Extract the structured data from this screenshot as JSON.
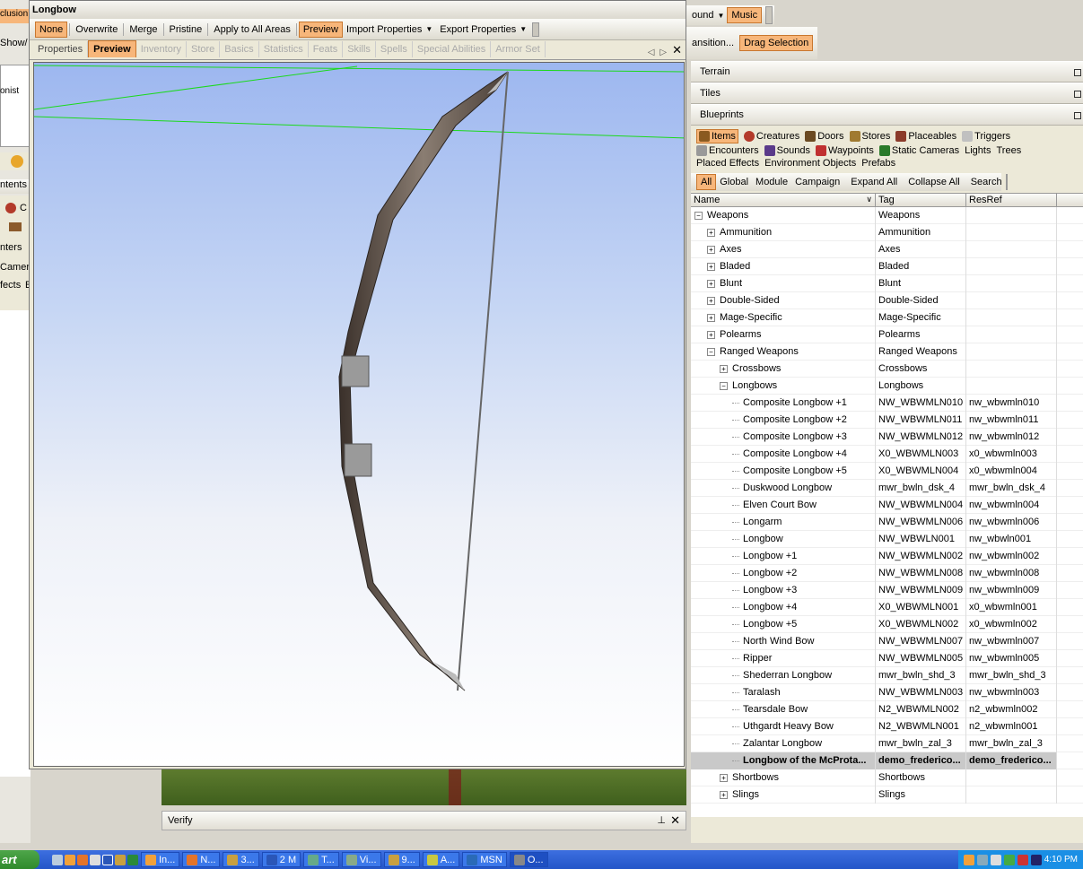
{
  "dialog": {
    "title": "Longbow",
    "toolbar": [
      "None",
      "Overwrite",
      "Merge",
      "Pristine",
      "Apply to All Areas",
      "Preview",
      "Import Properties",
      "Export Properties"
    ],
    "tabs": [
      "Properties",
      "Preview",
      "Inventory",
      "Store",
      "Basics",
      "Statistics",
      "Feats",
      "Skills",
      "Spells",
      "Special Abilities",
      "Armor Set"
    ]
  },
  "top_right": {
    "sound_label": "ound",
    "music": "Music",
    "transition": "ansition...",
    "drag_selection": "Drag Selection"
  },
  "left_fragments": {
    "inclusion": "clusion",
    "show": "Show/",
    "onist": "onist",
    "contents": "ntents",
    "c_item": "C",
    "ers": "nters",
    "camera": "Camer",
    "effects": "fects",
    "e": "E"
  },
  "sections": [
    "Terrain",
    "Tiles",
    "Blueprints"
  ],
  "blueprint_types": [
    "Items",
    "Creatures",
    "Doors",
    "Stores",
    "Placeables",
    "Triggers",
    "Encounters",
    "Sounds",
    "Waypoints",
    "Static Cameras",
    "Lights",
    "Trees",
    "Placed Effects",
    "Environment Objects",
    "Prefabs"
  ],
  "filter": [
    "All",
    "Global",
    "Module",
    "Campaign",
    "Expand All",
    "Collapse All",
    "Search"
  ],
  "columns": [
    "Name",
    "Tag",
    "ResRef"
  ],
  "rows": [
    {
      "lvl": 0,
      "exp": "−",
      "name": "Weapons",
      "tag": "Weapons",
      "res": ""
    },
    {
      "lvl": 1,
      "exp": "+",
      "name": "Ammunition",
      "tag": "Ammunition",
      "res": ""
    },
    {
      "lvl": 1,
      "exp": "+",
      "name": "Axes",
      "tag": "Axes",
      "res": ""
    },
    {
      "lvl": 1,
      "exp": "+",
      "name": "Bladed",
      "tag": "Bladed",
      "res": ""
    },
    {
      "lvl": 1,
      "exp": "+",
      "name": "Blunt",
      "tag": "Blunt",
      "res": ""
    },
    {
      "lvl": 1,
      "exp": "+",
      "name": "Double-Sided",
      "tag": "Double-Sided",
      "res": ""
    },
    {
      "lvl": 1,
      "exp": "+",
      "name": "Mage-Specific",
      "tag": "Mage-Specific",
      "res": ""
    },
    {
      "lvl": 1,
      "exp": "+",
      "name": "Polearms",
      "tag": "Polearms",
      "res": ""
    },
    {
      "lvl": 1,
      "exp": "−",
      "name": "Ranged Weapons",
      "tag": "Ranged Weapons",
      "res": ""
    },
    {
      "lvl": 2,
      "exp": "+",
      "name": "Crossbows",
      "tag": "Crossbows",
      "res": ""
    },
    {
      "lvl": 2,
      "exp": "−",
      "name": "Longbows",
      "tag": "Longbows",
      "res": ""
    },
    {
      "lvl": 3,
      "exp": "",
      "name": "Composite Longbow +1",
      "tag": "NW_WBWMLN010",
      "res": "nw_wbwmln010"
    },
    {
      "lvl": 3,
      "exp": "",
      "name": "Composite Longbow +2",
      "tag": "NW_WBWMLN011",
      "res": "nw_wbwmln011"
    },
    {
      "lvl": 3,
      "exp": "",
      "name": "Composite Longbow +3",
      "tag": "NW_WBWMLN012",
      "res": "nw_wbwmln012"
    },
    {
      "lvl": 3,
      "exp": "",
      "name": "Composite Longbow +4",
      "tag": "X0_WBWMLN003",
      "res": "x0_wbwmln003"
    },
    {
      "lvl": 3,
      "exp": "",
      "name": "Composite Longbow +5",
      "tag": "X0_WBWMLN004",
      "res": "x0_wbwmln004"
    },
    {
      "lvl": 3,
      "exp": "",
      "name": "Duskwood Longbow",
      "tag": "mwr_bwln_dsk_4",
      "res": "mwr_bwln_dsk_4"
    },
    {
      "lvl": 3,
      "exp": "",
      "name": "Elven Court Bow",
      "tag": "NW_WBWMLN004",
      "res": "nw_wbwmln004"
    },
    {
      "lvl": 3,
      "exp": "",
      "name": "Longarm",
      "tag": "NW_WBWMLN006",
      "res": "nw_wbwmln006"
    },
    {
      "lvl": 3,
      "exp": "",
      "name": "Longbow",
      "tag": "NW_WBWLN001",
      "res": "nw_wbwln001"
    },
    {
      "lvl": 3,
      "exp": "",
      "name": "Longbow +1",
      "tag": "NW_WBWMLN002",
      "res": "nw_wbwmln002"
    },
    {
      "lvl": 3,
      "exp": "",
      "name": "Longbow +2",
      "tag": "NW_WBWMLN008",
      "res": "nw_wbwmln008"
    },
    {
      "lvl": 3,
      "exp": "",
      "name": "Longbow +3",
      "tag": "NW_WBWMLN009",
      "res": "nw_wbwmln009"
    },
    {
      "lvl": 3,
      "exp": "",
      "name": "Longbow +4",
      "tag": "X0_WBWMLN001",
      "res": "x0_wbwmln001"
    },
    {
      "lvl": 3,
      "exp": "",
      "name": "Longbow +5",
      "tag": "X0_WBWMLN002",
      "res": "x0_wbwmln002"
    },
    {
      "lvl": 3,
      "exp": "",
      "name": "North Wind Bow",
      "tag": "NW_WBWMLN007",
      "res": "nw_wbwmln007"
    },
    {
      "lvl": 3,
      "exp": "",
      "name": "Ripper",
      "tag": "NW_WBWMLN005",
      "res": "nw_wbwmln005"
    },
    {
      "lvl": 3,
      "exp": "",
      "name": "Shederran Longbow",
      "tag": "mwr_bwln_shd_3",
      "res": "mwr_bwln_shd_3"
    },
    {
      "lvl": 3,
      "exp": "",
      "name": "Taralash",
      "tag": "NW_WBWMLN003",
      "res": "nw_wbwmln003"
    },
    {
      "lvl": 3,
      "exp": "",
      "name": "Tearsdale Bow",
      "tag": "N2_WBWMLN002",
      "res": "n2_wbwmln002"
    },
    {
      "lvl": 3,
      "exp": "",
      "name": "Uthgardt Heavy Bow",
      "tag": "N2_WBWMLN001",
      "res": "n2_wbwmln001"
    },
    {
      "lvl": 3,
      "exp": "",
      "name": "Zalantar Longbow",
      "tag": "mwr_bwln_zal_3",
      "res": "mwr_bwln_zal_3"
    },
    {
      "lvl": 3,
      "exp": "",
      "name": "Longbow of the McProta...",
      "tag": "demo_frederico...",
      "res": "demo_frederico...",
      "sel": true
    },
    {
      "lvl": 2,
      "exp": "+",
      "name": "Shortbows",
      "tag": "Shortbows",
      "res": ""
    },
    {
      "lvl": 2,
      "exp": "+",
      "name": "Slings",
      "tag": "Slings",
      "res": ""
    }
  ],
  "verify": "Verify",
  "taskbar": {
    "start": "art",
    "tasks": [
      "In...",
      "N...",
      "3...",
      "2 M",
      "T...",
      "Vi...",
      "9...",
      "A...",
      "MSN",
      "O..."
    ],
    "clock": "4:10 PM"
  }
}
